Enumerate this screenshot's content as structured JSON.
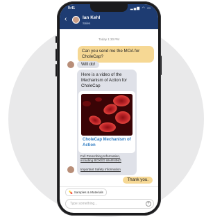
{
  "status": {
    "time": "9:41",
    "icons": "▂▄▆ ◠ ▭"
  },
  "header": {
    "back": "‹",
    "name": "Ian Kehl",
    "role": "Sales"
  },
  "chat": {
    "timestamp": "Today 1:30 PM",
    "messages": [
      {
        "side": "out",
        "text": "Can you send me the MOA for CholeCap?"
      },
      {
        "side": "in",
        "text": "Will do!"
      },
      {
        "side": "in",
        "text": "Here is a video of the Mechanism of Action for CholeCap"
      },
      {
        "side": "out",
        "text": "Thank you."
      }
    ],
    "card": {
      "title": "CholeCap Mechanism of Action",
      "link_prescribing": "Full Prescribing Information, including BOXED WARNING",
      "link_safety": "Important Safety Information"
    }
  },
  "chip": {
    "icon": "💊",
    "label": "Samples & Materials"
  },
  "input": {
    "placeholder": "Type something...",
    "add_icon": "+"
  },
  "colors": {
    "header": "#1e3c72",
    "outgoing": "#f6d894",
    "incoming": "#dfe1e8",
    "link": "#2f7cc2"
  }
}
